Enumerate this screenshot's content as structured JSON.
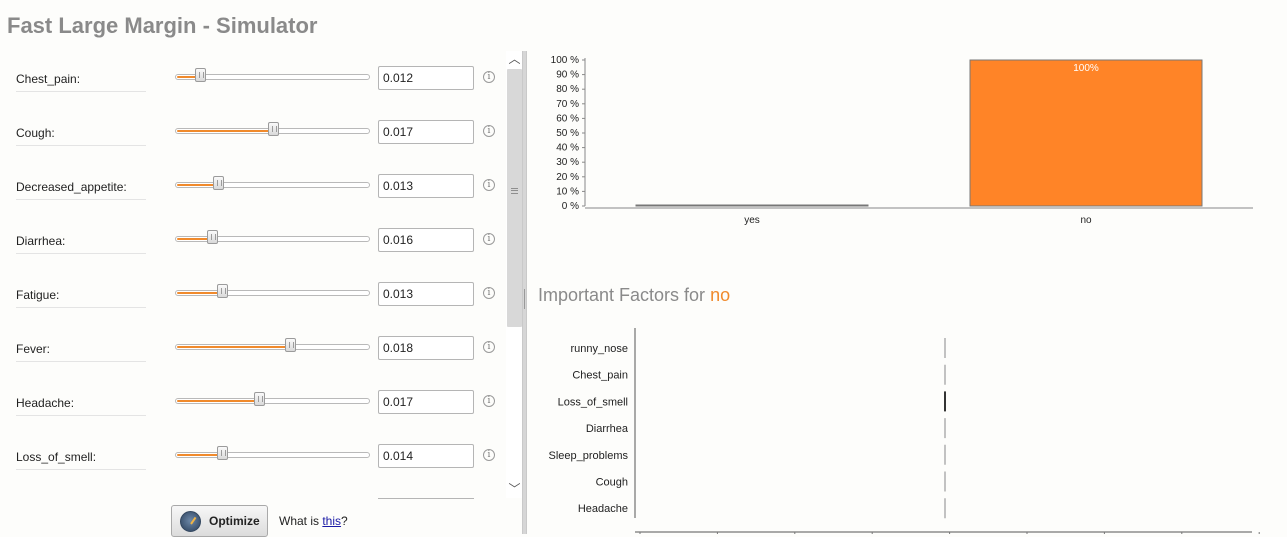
{
  "app": {
    "title": "Fast Large Margin - Simulator"
  },
  "params": [
    {
      "name": "Chest_pain:",
      "value": "0.012",
      "fraction": 0.13
    },
    {
      "name": "Cough:",
      "value": "0.017",
      "fraction": 0.5
    },
    {
      "name": "Decreased_appetite:",
      "value": "0.013",
      "fraction": 0.22
    },
    {
      "name": "Diarrhea:",
      "value": "0.016",
      "fraction": 0.19
    },
    {
      "name": "Fatigue:",
      "value": "0.013",
      "fraction": 0.24
    },
    {
      "name": "Fever:",
      "value": "0.018",
      "fraction": 0.59
    },
    {
      "name": "Headache:",
      "value": "0.017",
      "fraction": 0.43
    },
    {
      "name": "Loss_of_smell:",
      "value": "0.014",
      "fraction": 0.24
    }
  ],
  "icons": {
    "info": "info-icon",
    "scroll_up": "▲",
    "scroll_down": "▼",
    "optimize": "gauge-icon"
  },
  "scrollbar": {
    "up_glyph": "︿",
    "down_glyph": "﹀"
  },
  "optimize": {
    "label": "Optimize"
  },
  "whatis": {
    "prefix": "What is ",
    "link": "this",
    "suffix": "?"
  },
  "colors": {
    "accent": "#f08a2c",
    "bar": "#ff8427",
    "title": "#8a8a8a"
  },
  "chart_data": {
    "type": "bar",
    "categories": [
      "yes",
      "no"
    ],
    "values": [
      0,
      100
    ],
    "data_labels": [
      "",
      "100%"
    ],
    "ylim": [
      0,
      100
    ],
    "yticks": [
      "0 %",
      "10 %",
      "20 %",
      "30 %",
      "40 %",
      "50 %",
      "60 %",
      "70 %",
      "80 %",
      "90 %",
      "100 %"
    ]
  },
  "factors": {
    "title_prefix": "Important Factors for ",
    "title_class": "no",
    "items": [
      "runny_nose",
      "Chest_pain",
      "Loss_of_smell",
      "Diarrhea",
      "Sleep_problems",
      "Cough",
      "Headache"
    ]
  }
}
